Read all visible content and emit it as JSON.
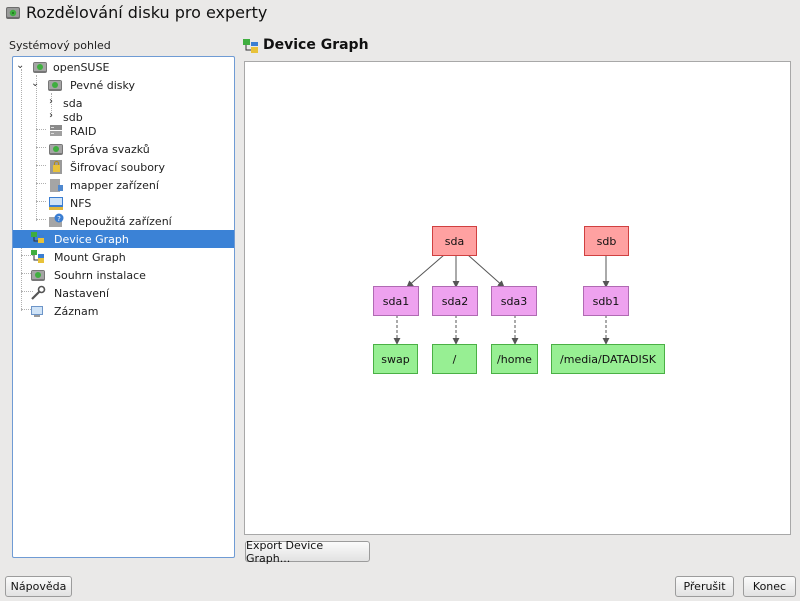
{
  "window": {
    "title": "Rozdělování disku pro experty"
  },
  "tree": {
    "label": "Systémový pohled",
    "items": [
      {
        "label": "openSUSE",
        "icon": "hard-disk-icon"
      },
      {
        "label": "Pevné disky",
        "icon": "hard-disk-icon"
      },
      {
        "label": "sda"
      },
      {
        "label": "sdb"
      },
      {
        "label": "RAID",
        "icon": "raid-icon"
      },
      {
        "label": "Správa svazků",
        "icon": "volume-manager-icon"
      },
      {
        "label": "Šifrovací soubory",
        "icon": "lock-icon"
      },
      {
        "label": "mapper zařízení",
        "icon": "device-mapper-icon"
      },
      {
        "label": "NFS",
        "icon": "nfs-icon"
      },
      {
        "label": "Nepoužitá zařízení",
        "icon": "unused-device-icon"
      },
      {
        "label": "Device Graph",
        "icon": "device-graph-icon"
      },
      {
        "label": "Mount Graph",
        "icon": "mount-graph-icon"
      },
      {
        "label": "Souhrn instalace",
        "icon": "install-summary-icon"
      },
      {
        "label": "Nastavení",
        "icon": "settings-wrench-icon"
      },
      {
        "label": "Záznam",
        "icon": "log-monitor-icon"
      }
    ]
  },
  "graph": {
    "title": "Device Graph",
    "nodes": {
      "sda": "sda",
      "sdb": "sdb",
      "sda1": "sda1",
      "sda2": "sda2",
      "sda3": "sda3",
      "sdb1": "sdb1",
      "swap": "swap",
      "root": "/",
      "home": "/home",
      "datadisk": "/media/DATADISK"
    },
    "colors": {
      "disk": "#ffa1a1",
      "partition": "#eea2ef",
      "mount": "#97ef93"
    }
  },
  "buttons": {
    "export": "Export Device Graph...",
    "help": "Nápověda",
    "abort": "Přerušit",
    "finish": "Konec"
  }
}
